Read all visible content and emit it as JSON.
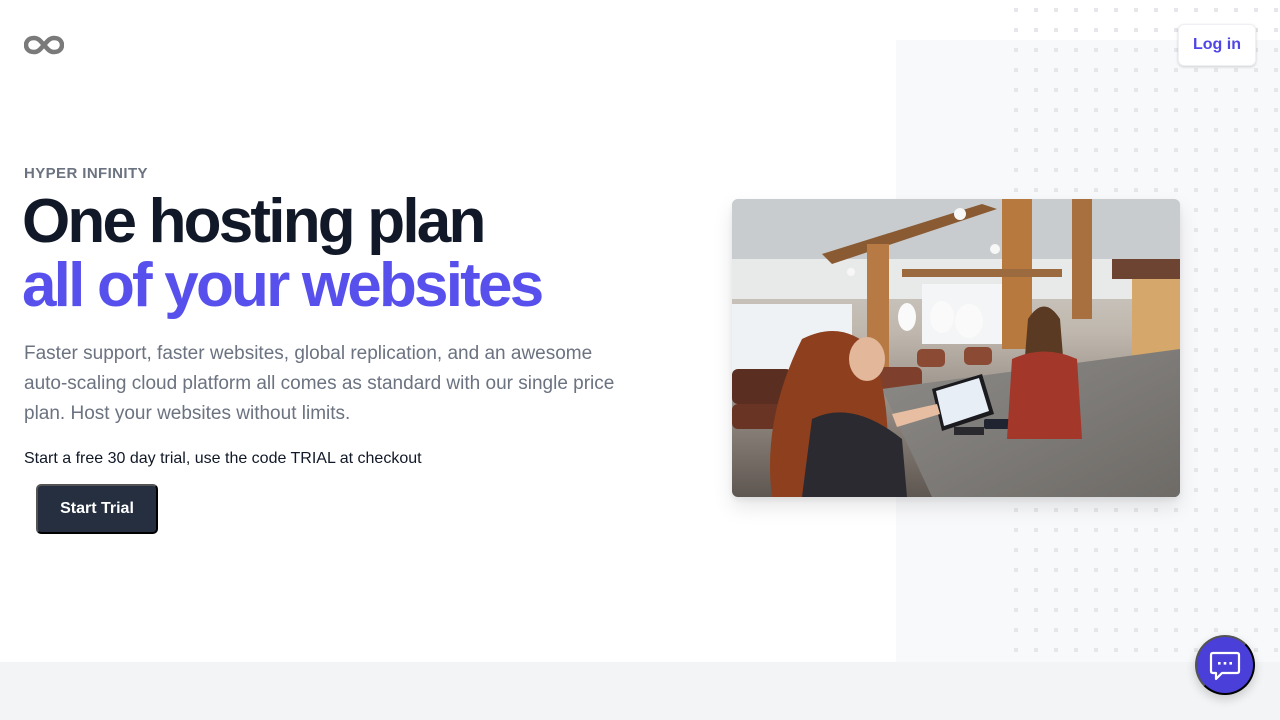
{
  "brand": {
    "logo_icon": "infinity-icon",
    "logo_color": "#7a7a7a",
    "accent_color": "#5850ec"
  },
  "header": {
    "login_label": "Log in"
  },
  "hero": {
    "eyebrow": "HYPER INFINITY",
    "headline_line1": "One hosting plan",
    "headline_line2": "all of your websites",
    "lede": "Faster support, faster websites, global replication, and an awesome auto-scaling cloud platform all comes as standard with our single price plan. Host your websites without limits.",
    "trial_note": "Start a free 30 day trial, use the code TRIAL at checkout",
    "cta_label": "Start Trial",
    "image_alt": "Two women at a salon reception counter with a tablet point-of-sale terminal"
  },
  "chat_widget": {
    "icon": "chat-bubble-icon"
  }
}
